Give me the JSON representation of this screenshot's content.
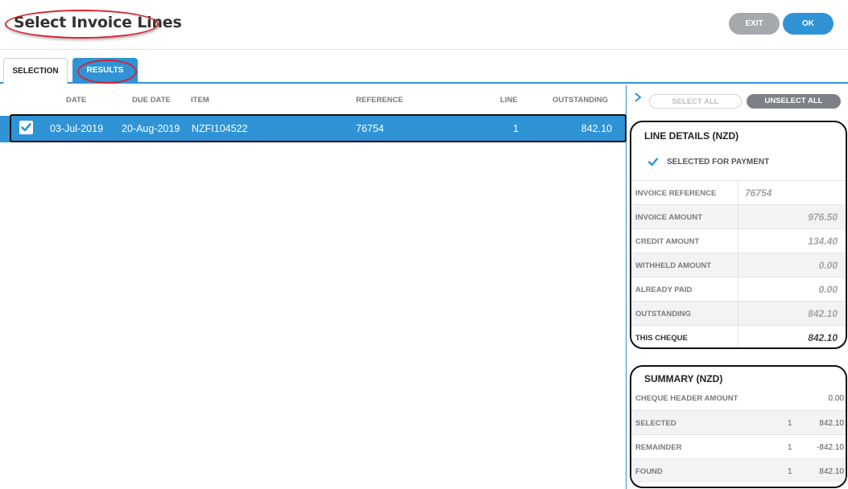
{
  "header": {
    "title": "Select Invoice Lines",
    "exit_label": "EXIT",
    "ok_label": "OK"
  },
  "tabs": [
    {
      "label": "SELECTION",
      "active": false
    },
    {
      "label": "RESULTS",
      "active": true
    }
  ],
  "grid": {
    "columns": [
      "DATE",
      "DUE DATE",
      "ITEM",
      "REFERENCE",
      "LINE",
      "OUTSTANDING"
    ],
    "rows": [
      {
        "checked": true,
        "date": "03-Jul-2019",
        "due_date": "20-Aug-2019",
        "item": "NZFI104522",
        "reference": "76754",
        "line": "1",
        "outstanding": "842.10"
      }
    ]
  },
  "side": {
    "select_all_label": "SELECT ALL",
    "unselect_all_label": "UNSELECT ALL",
    "line_details": {
      "title": "LINE DETAILS (NZD)",
      "selected_for_payment_label": "SELECTED FOR PAYMENT",
      "selected_for_payment": true,
      "rows": [
        {
          "label": "INVOICE REFERENCE",
          "value": "76754"
        },
        {
          "label": "INVOICE AMOUNT",
          "value": "976.50"
        },
        {
          "label": "CREDIT AMOUNT",
          "value": "134.40"
        },
        {
          "label": "WITHHELD AMOUNT",
          "value": "0.00"
        },
        {
          "label": "ALREADY PAID",
          "value": "0.00"
        },
        {
          "label": "OUTSTANDING",
          "value": "842.10"
        },
        {
          "label": "THIS CHEQUE",
          "value": "842.10"
        }
      ]
    },
    "summary": {
      "title": "SUMMARY (NZD)",
      "rows": [
        {
          "label": "CHEQUE HEADER AMOUNT",
          "count": "",
          "value": "0.00"
        },
        {
          "label": "SELECTED",
          "count": "1",
          "value": "842.10"
        },
        {
          "label": "REMAINDER",
          "count": "1",
          "value": "-842.10"
        },
        {
          "label": "FOUND",
          "count": "1",
          "value": "842.10"
        }
      ]
    }
  },
  "colors": {
    "accent": "#2f93d6",
    "exit_button": "#a5a8ad",
    "annotation_red": "#d9232d"
  }
}
